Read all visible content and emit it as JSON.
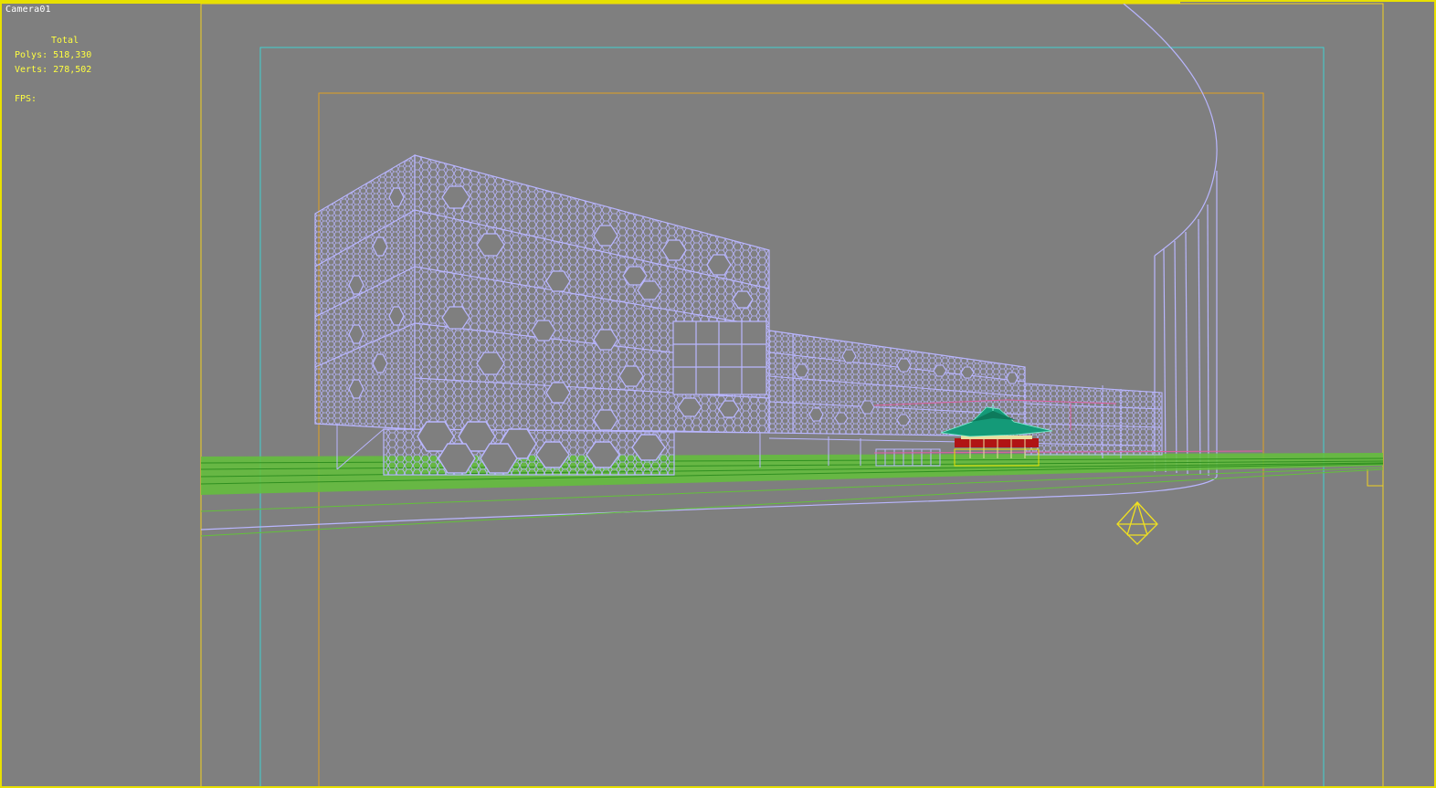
{
  "viewport": {
    "label": "Camera01",
    "border_color": "#e8e000",
    "background": "#7f7f7f"
  },
  "stats": {
    "total_label": "Total",
    "polys_label": "Polys:",
    "polys_value": "518,330",
    "verts_label": "Verts:",
    "verts_value": "278,502",
    "fps_label": "FPS:"
  },
  "scene": {
    "wireframe_color": "#b9b6ff",
    "ground_color": "#63c13a",
    "safe_frame_outer_color": "#f0d020",
    "safe_frame_action_color": "#40d0d0",
    "safe_frame_title_color": "#e0a020",
    "pavilion_roof_color": "#149a78",
    "pavilion_base_color": "#b01414",
    "camera_target_icon": "diamond-icon"
  }
}
